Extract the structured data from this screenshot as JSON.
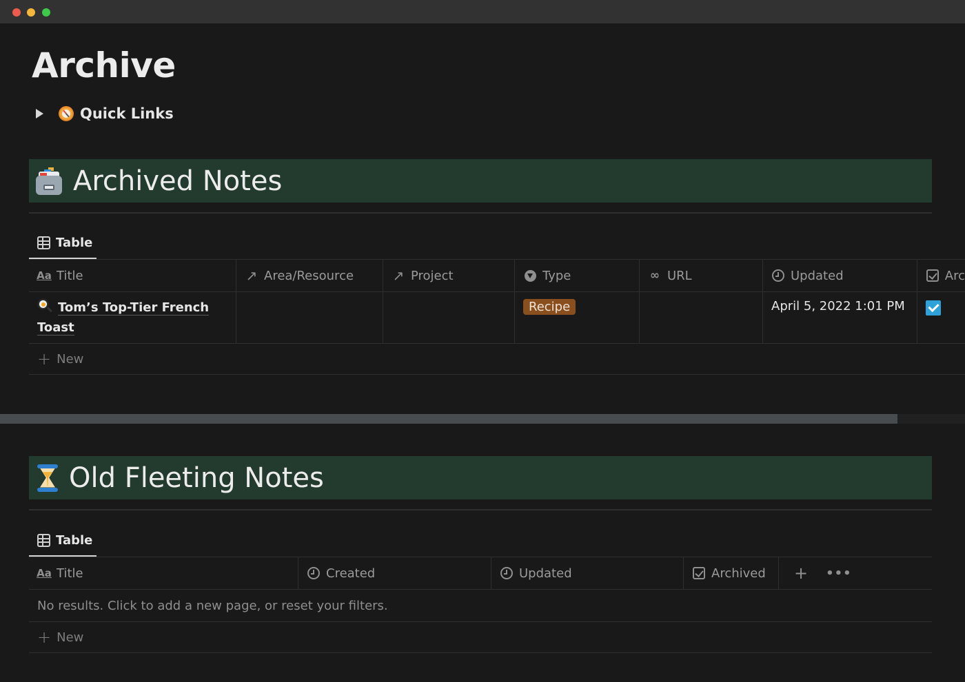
{
  "window": {
    "controls": [
      "close",
      "minimize",
      "maximize"
    ]
  },
  "page": {
    "title": "Archive"
  },
  "quick_links": {
    "label": "Quick Links",
    "icon": "compass-icon",
    "expanded": false
  },
  "databases": [
    {
      "title": "Archived Notes",
      "icon": "card-file-box-icon",
      "view_tab": "Table",
      "columns": [
        {
          "label": "Title",
          "icon": "text-aa-icon"
        },
        {
          "label": "Area/Resource",
          "icon": "relation-arrow-icon"
        },
        {
          "label": "Project",
          "icon": "relation-arrow-icon"
        },
        {
          "label": "Type",
          "icon": "select-icon"
        },
        {
          "label": "URL",
          "icon": "link-icon"
        },
        {
          "label": "Updated",
          "icon": "clock-icon"
        },
        {
          "label": "Arc",
          "icon": "checkbox-icon"
        }
      ],
      "rows": [
        {
          "title": "Tom’s Top-Tier French Toast",
          "title_line1": "Tom’s Top-Tier French",
          "title_line2": "Toast",
          "icon": "frying-pan-egg-icon",
          "area_resource": "",
          "project": "",
          "type": "Recipe",
          "type_color": "#8a4f1f",
          "url": "",
          "updated": "April 5, 2022 1:01 PM",
          "archived": true
        }
      ],
      "new_label": "New"
    },
    {
      "title": "Old Fleeting Notes",
      "icon": "hourglass-icon",
      "view_tab": "Table",
      "columns": [
        {
          "label": "Title",
          "icon": "text-aa-icon"
        },
        {
          "label": "Created",
          "icon": "clock-icon"
        },
        {
          "label": "Updated",
          "icon": "clock-icon"
        },
        {
          "label": "Archived",
          "icon": "checkbox-icon"
        }
      ],
      "empty_message": "No results. Click to add a new page, or reset your filters.",
      "new_label": "New"
    }
  ],
  "scrollbar": {
    "horizontal_position_percent": 93
  },
  "colors": {
    "background": "#191919",
    "banner": "#233a2e",
    "checkbox": "#2ea2d8",
    "tag_recipe": "#8a4f1f"
  }
}
